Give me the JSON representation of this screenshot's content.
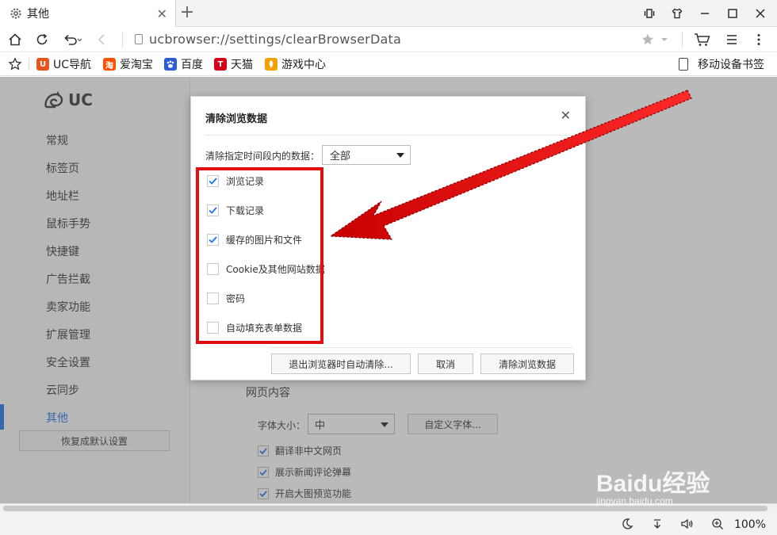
{
  "tab": {
    "title": "其他",
    "close": "✕",
    "new_tab": "+"
  },
  "address": {
    "url": "ucbrowser://settings/clearBrowserData"
  },
  "bookmarks": [
    {
      "label": "UC导航",
      "icon": "uc-nav-icon",
      "color": "#e8541e"
    },
    {
      "label": "爱淘宝",
      "icon": "taobao-icon",
      "color": "#ff5000"
    },
    {
      "label": "百度",
      "icon": "baidu-paw-icon",
      "color": "#2b5bd6"
    },
    {
      "label": "天猫",
      "icon": "tmall-icon",
      "color": "#d4001a"
    },
    {
      "label": "游戏中心",
      "icon": "game-center-icon",
      "color": "#f3a000"
    }
  ],
  "mobile_bookmarks": "移动设备书签",
  "sidebar": {
    "logo_text": "UC",
    "items": [
      "常规",
      "标签页",
      "地址栏",
      "鼠标手势",
      "快捷键",
      "广告拦截",
      "卖家功能",
      "扩展管理",
      "安全设置",
      "云同步",
      "其他"
    ],
    "active": "其他",
    "reset_label": "恢复成默认设置"
  },
  "main": {
    "section_title": "网页内容",
    "font_size_label": "字体大小：",
    "font_size_value": "中",
    "custom_font_label": "自定义字体...",
    "options": [
      {
        "label": "翻译非中文网页",
        "checked": true
      },
      {
        "label": "展示新闻评论弹幕",
        "checked": true
      },
      {
        "label": "开启大图预览功能",
        "checked": true
      }
    ]
  },
  "dialog": {
    "title": "清除浏览数据",
    "close": "✕",
    "range_label": "清除指定时间段内的数据：",
    "range_value": "全部",
    "options": [
      {
        "label": "浏览记录",
        "checked": true
      },
      {
        "label": "下载记录",
        "checked": true
      },
      {
        "label": "缓存的图片和文件",
        "checked": true
      },
      {
        "label": "Cookie及其他网站数据",
        "checked": false
      },
      {
        "label": "密码",
        "checked": false
      },
      {
        "label": "自动填充表单数据",
        "checked": false
      }
    ],
    "auto_clear_label": "退出浏览器时自动清除...",
    "cancel_label": "取消",
    "clear_label": "清除浏览数据"
  },
  "status": {
    "zoom": "100%"
  },
  "watermark": {
    "main": "Baidu经验",
    "sub": "jingyan.baidu.com"
  },
  "colors": {
    "accent": "#1a73e8",
    "annotation": "#e01010",
    "check": "#1a73e8"
  }
}
